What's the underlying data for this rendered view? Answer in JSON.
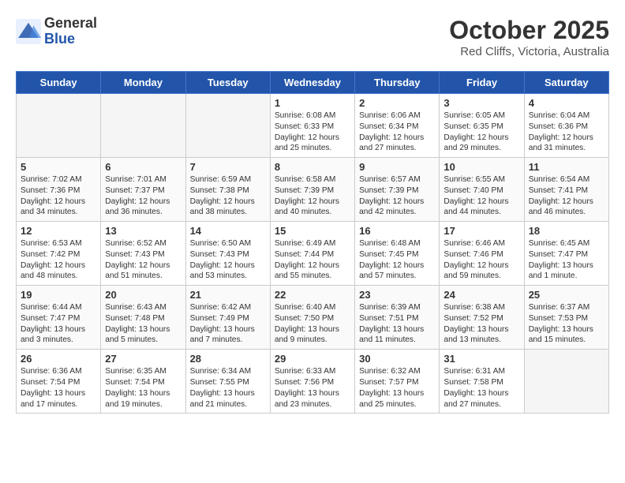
{
  "header": {
    "logo_general": "General",
    "logo_blue": "Blue",
    "month_year": "October 2025",
    "location": "Red Cliffs, Victoria, Australia"
  },
  "weekdays": [
    "Sunday",
    "Monday",
    "Tuesday",
    "Wednesday",
    "Thursday",
    "Friday",
    "Saturday"
  ],
  "weeks": [
    [
      {
        "day": "",
        "text": ""
      },
      {
        "day": "",
        "text": ""
      },
      {
        "day": "",
        "text": ""
      },
      {
        "day": "1",
        "text": "Sunrise: 6:08 AM\nSunset: 6:33 PM\nDaylight: 12 hours\nand 25 minutes."
      },
      {
        "day": "2",
        "text": "Sunrise: 6:06 AM\nSunset: 6:34 PM\nDaylight: 12 hours\nand 27 minutes."
      },
      {
        "day": "3",
        "text": "Sunrise: 6:05 AM\nSunset: 6:35 PM\nDaylight: 12 hours\nand 29 minutes."
      },
      {
        "day": "4",
        "text": "Sunrise: 6:04 AM\nSunset: 6:36 PM\nDaylight: 12 hours\nand 31 minutes."
      }
    ],
    [
      {
        "day": "5",
        "text": "Sunrise: 7:02 AM\nSunset: 7:36 PM\nDaylight: 12 hours\nand 34 minutes."
      },
      {
        "day": "6",
        "text": "Sunrise: 7:01 AM\nSunset: 7:37 PM\nDaylight: 12 hours\nand 36 minutes."
      },
      {
        "day": "7",
        "text": "Sunrise: 6:59 AM\nSunset: 7:38 PM\nDaylight: 12 hours\nand 38 minutes."
      },
      {
        "day": "8",
        "text": "Sunrise: 6:58 AM\nSunset: 7:39 PM\nDaylight: 12 hours\nand 40 minutes."
      },
      {
        "day": "9",
        "text": "Sunrise: 6:57 AM\nSunset: 7:39 PM\nDaylight: 12 hours\nand 42 minutes."
      },
      {
        "day": "10",
        "text": "Sunrise: 6:55 AM\nSunset: 7:40 PM\nDaylight: 12 hours\nand 44 minutes."
      },
      {
        "day": "11",
        "text": "Sunrise: 6:54 AM\nSunset: 7:41 PM\nDaylight: 12 hours\nand 46 minutes."
      }
    ],
    [
      {
        "day": "12",
        "text": "Sunrise: 6:53 AM\nSunset: 7:42 PM\nDaylight: 12 hours\nand 48 minutes."
      },
      {
        "day": "13",
        "text": "Sunrise: 6:52 AM\nSunset: 7:43 PM\nDaylight: 12 hours\nand 51 minutes."
      },
      {
        "day": "14",
        "text": "Sunrise: 6:50 AM\nSunset: 7:43 PM\nDaylight: 12 hours\nand 53 minutes."
      },
      {
        "day": "15",
        "text": "Sunrise: 6:49 AM\nSunset: 7:44 PM\nDaylight: 12 hours\nand 55 minutes."
      },
      {
        "day": "16",
        "text": "Sunrise: 6:48 AM\nSunset: 7:45 PM\nDaylight: 12 hours\nand 57 minutes."
      },
      {
        "day": "17",
        "text": "Sunrise: 6:46 AM\nSunset: 7:46 PM\nDaylight: 12 hours\nand 59 minutes."
      },
      {
        "day": "18",
        "text": "Sunrise: 6:45 AM\nSunset: 7:47 PM\nDaylight: 13 hours\nand 1 minute."
      }
    ],
    [
      {
        "day": "19",
        "text": "Sunrise: 6:44 AM\nSunset: 7:47 PM\nDaylight: 13 hours\nand 3 minutes."
      },
      {
        "day": "20",
        "text": "Sunrise: 6:43 AM\nSunset: 7:48 PM\nDaylight: 13 hours\nand 5 minutes."
      },
      {
        "day": "21",
        "text": "Sunrise: 6:42 AM\nSunset: 7:49 PM\nDaylight: 13 hours\nand 7 minutes."
      },
      {
        "day": "22",
        "text": "Sunrise: 6:40 AM\nSunset: 7:50 PM\nDaylight: 13 hours\nand 9 minutes."
      },
      {
        "day": "23",
        "text": "Sunrise: 6:39 AM\nSunset: 7:51 PM\nDaylight: 13 hours\nand 11 minutes."
      },
      {
        "day": "24",
        "text": "Sunrise: 6:38 AM\nSunset: 7:52 PM\nDaylight: 13 hours\nand 13 minutes."
      },
      {
        "day": "25",
        "text": "Sunrise: 6:37 AM\nSunset: 7:53 PM\nDaylight: 13 hours\nand 15 minutes."
      }
    ],
    [
      {
        "day": "26",
        "text": "Sunrise: 6:36 AM\nSunset: 7:54 PM\nDaylight: 13 hours\nand 17 minutes."
      },
      {
        "day": "27",
        "text": "Sunrise: 6:35 AM\nSunset: 7:54 PM\nDaylight: 13 hours\nand 19 minutes."
      },
      {
        "day": "28",
        "text": "Sunrise: 6:34 AM\nSunset: 7:55 PM\nDaylight: 13 hours\nand 21 minutes."
      },
      {
        "day": "29",
        "text": "Sunrise: 6:33 AM\nSunset: 7:56 PM\nDaylight: 13 hours\nand 23 minutes."
      },
      {
        "day": "30",
        "text": "Sunrise: 6:32 AM\nSunset: 7:57 PM\nDaylight: 13 hours\nand 25 minutes."
      },
      {
        "day": "31",
        "text": "Sunrise: 6:31 AM\nSunset: 7:58 PM\nDaylight: 13 hours\nand 27 minutes."
      },
      {
        "day": "",
        "text": ""
      }
    ]
  ]
}
